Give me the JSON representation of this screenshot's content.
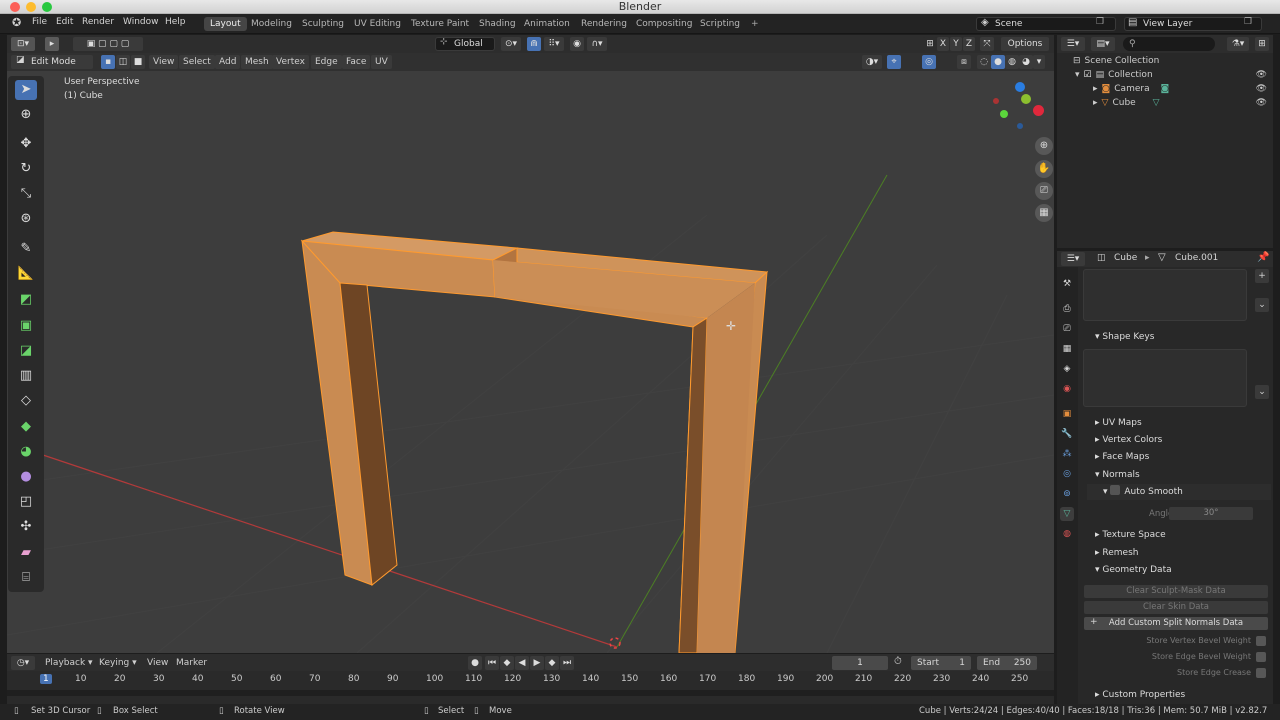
{
  "window": {
    "title": "Blender"
  },
  "menubar": {
    "items": [
      "File",
      "Edit",
      "Render",
      "Window",
      "Help"
    ]
  },
  "workspaces": [
    "Layout",
    "Modeling",
    "Sculpting",
    "UV Editing",
    "Texture Paint",
    "Shading",
    "Animation",
    "Rendering",
    "Compositing",
    "Scripting"
  ],
  "scene": {
    "label": "Scene"
  },
  "view_layer": {
    "label": "View Layer"
  },
  "viewport": {
    "header1": {
      "orientation": "Global",
      "options": "Options"
    },
    "header2": {
      "mode": "Edit Mode",
      "menus": [
        "View",
        "Select",
        "Add",
        "Mesh",
        "Vertex",
        "Edge",
        "Face",
        "UV"
      ]
    },
    "overlay": {
      "line1": "User Perspective",
      "line2": "(1) Cube"
    },
    "gizmo": {
      "axis_x": "X",
      "axis_y": "Y",
      "axis_z": "Z"
    }
  },
  "outliner": {
    "items": [
      "Scene Collection",
      "Collection",
      "Camera",
      "Cube"
    ]
  },
  "properties": {
    "breadcrumb": {
      "object": "Cube",
      "mesh": "Cube.001"
    },
    "sections": {
      "shape_keys": "Shape Keys",
      "uv_maps": "UV Maps",
      "vertex_colors": "Vertex Colors",
      "face_maps": "Face Maps",
      "normals": "Normals",
      "auto_smooth": "Auto Smooth",
      "angle_label": "Angle",
      "angle_value": "30°",
      "texture_space": "Texture Space",
      "remesh": "Remesh",
      "geometry_data": "Geometry Data",
      "custom_properties": "Custom Properties"
    },
    "buttons": {
      "clear_sculpt": "Clear Sculpt-Mask Data",
      "clear_skin": "Clear Skin Data",
      "add_normals": "Add Custom Split Normals Data"
    },
    "store": {
      "vertex_bevel": "Store Vertex Bevel Weight",
      "edge_bevel": "Store Edge Bevel Weight",
      "edge_crease": "Store Edge Crease"
    }
  },
  "timeline": {
    "menus": [
      "Playback",
      "Keying",
      "View",
      "Marker"
    ],
    "current_frame": "1",
    "start_label": "Start",
    "start_value": "1",
    "end_label": "End",
    "end_value": "250",
    "ticks": [
      "1",
      "10",
      "20",
      "30",
      "40",
      "50",
      "60",
      "70",
      "80",
      "90",
      "100",
      "110",
      "120",
      "130",
      "140",
      "150",
      "160",
      "170",
      "180",
      "190",
      "200",
      "210",
      "220",
      "230",
      "240",
      "250"
    ]
  },
  "statusbar": {
    "set_cursor": "Set 3D Cursor",
    "box_select": "Box Select",
    "rotate_view": "Rotate View",
    "select": "Select",
    "move": "Move",
    "stats": "Cube | Verts:24/24 | Edges:40/40 | Faces:18/18 | Tris:36 | Mem: 50.7 MiB | v2.82.7"
  },
  "colors": {
    "accent": "#4772b3",
    "mesh": "#c98b52",
    "selected_edge": "#ff9a2e",
    "x_axis": "#c23b3b",
    "y_axis": "#5a9a2a"
  }
}
